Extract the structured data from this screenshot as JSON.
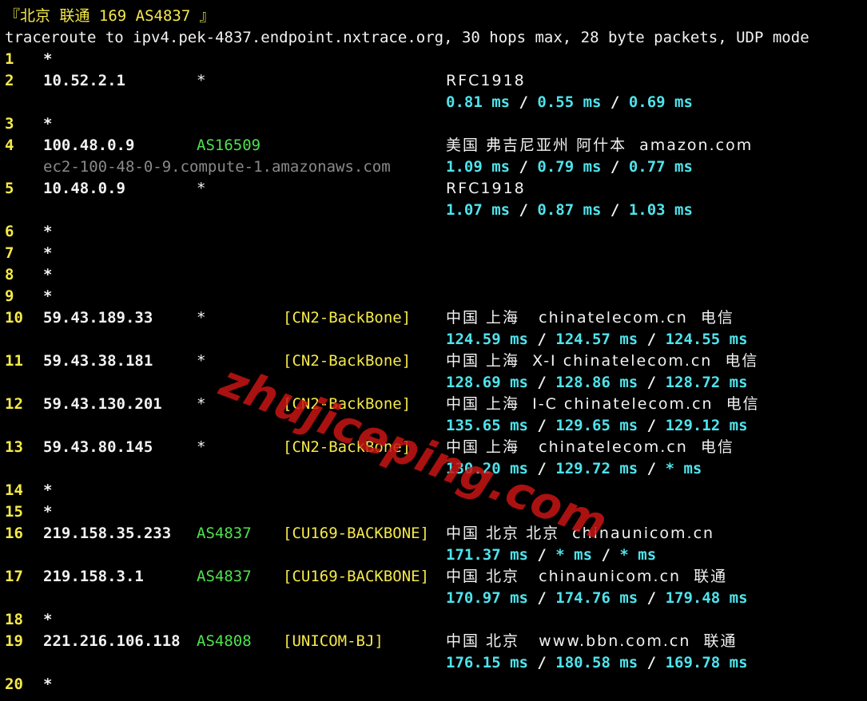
{
  "header": {
    "title": "『北京 联通 169 AS4837 』",
    "command": "traceroute to ipv4.pek-4837.endpoint.nxtrace.org, 30 hops max, 28 byte packets, UDP mode"
  },
  "hops": [
    {
      "n": "1",
      "ip": "*"
    },
    {
      "n": "2",
      "ip": "10.52.2.1",
      "asn": "*",
      "info": "RFC1918",
      "rtt": [
        "0.81",
        "0.55",
        "0.69"
      ]
    },
    {
      "n": "3",
      "ip": "*"
    },
    {
      "n": "4",
      "ip": "100.48.0.9",
      "asn": "AS16509",
      "info": "美国 弗吉尼亚州 阿什本  amazon.com",
      "host": "ec2-100-48-0-9.compute-1.amazonaws.com",
      "rtt": [
        "1.09",
        "0.79",
        "0.77"
      ]
    },
    {
      "n": "5",
      "ip": "10.48.0.9",
      "asn": "*",
      "info": "RFC1918",
      "rtt": [
        "1.07",
        "0.87",
        "1.03"
      ]
    },
    {
      "n": "6",
      "ip": "*"
    },
    {
      "n": "7",
      "ip": "*"
    },
    {
      "n": "8",
      "ip": "*"
    },
    {
      "n": "9",
      "ip": "*"
    },
    {
      "n": "10",
      "ip": "59.43.189.33",
      "asn": "*",
      "tag": "[CN2-BackBone]",
      "info": "中国 上海   chinatelecom.cn  电信",
      "rtt": [
        "124.59",
        "124.57",
        "124.55"
      ]
    },
    {
      "n": "11",
      "ip": "59.43.38.181",
      "asn": "*",
      "tag": "[CN2-BackBone]",
      "info": "中国 上海  X-I chinatelecom.cn  电信",
      "rtt": [
        "128.69",
        "128.86",
        "128.72"
      ]
    },
    {
      "n": "12",
      "ip": "59.43.130.201",
      "asn": "*",
      "tag": "[CN2-BackBone]",
      "info": "中国 上海  I-C chinatelecom.cn  电信",
      "rtt": [
        "135.65",
        "129.65",
        "129.12"
      ]
    },
    {
      "n": "13",
      "ip": "59.43.80.145",
      "asn": "*",
      "tag": "[CN2-BackBone]",
      "info": "中国 上海   chinatelecom.cn  电信",
      "rtt": [
        "130.20",
        "129.72",
        "*"
      ]
    },
    {
      "n": "14",
      "ip": "*"
    },
    {
      "n": "15",
      "ip": "*"
    },
    {
      "n": "16",
      "ip": "219.158.35.233",
      "asn": "AS4837",
      "tag": "[CU169-BACKBONE]",
      "info": "中国 北京 北京  chinaunicom.cn",
      "rtt": [
        "171.37",
        "*",
        "*"
      ]
    },
    {
      "n": "17",
      "ip": "219.158.3.1",
      "asn": "AS4837",
      "tag": "[CU169-BACKBONE]",
      "info": "中国 北京   chinaunicom.cn  联通",
      "rtt": [
        "170.97",
        "174.76",
        "179.48"
      ]
    },
    {
      "n": "18",
      "ip": "*"
    },
    {
      "n": "19",
      "ip": "221.216.106.118",
      "asn": "AS4808",
      "tag": "[UNICOM-BJ]",
      "info": "中国 北京   www.bbn.com.cn  联通",
      "rtt": [
        "176.15",
        "180.58",
        "169.78"
      ]
    },
    {
      "n": "20",
      "ip": "*"
    }
  ],
  "watermark": "zhujiceping.com",
  "colors": {
    "background": "#000000",
    "hop": "#f5e94a",
    "asn": "#4ee24e",
    "rtt": "#4fe3ec",
    "hostname": "#8a8a8a"
  }
}
